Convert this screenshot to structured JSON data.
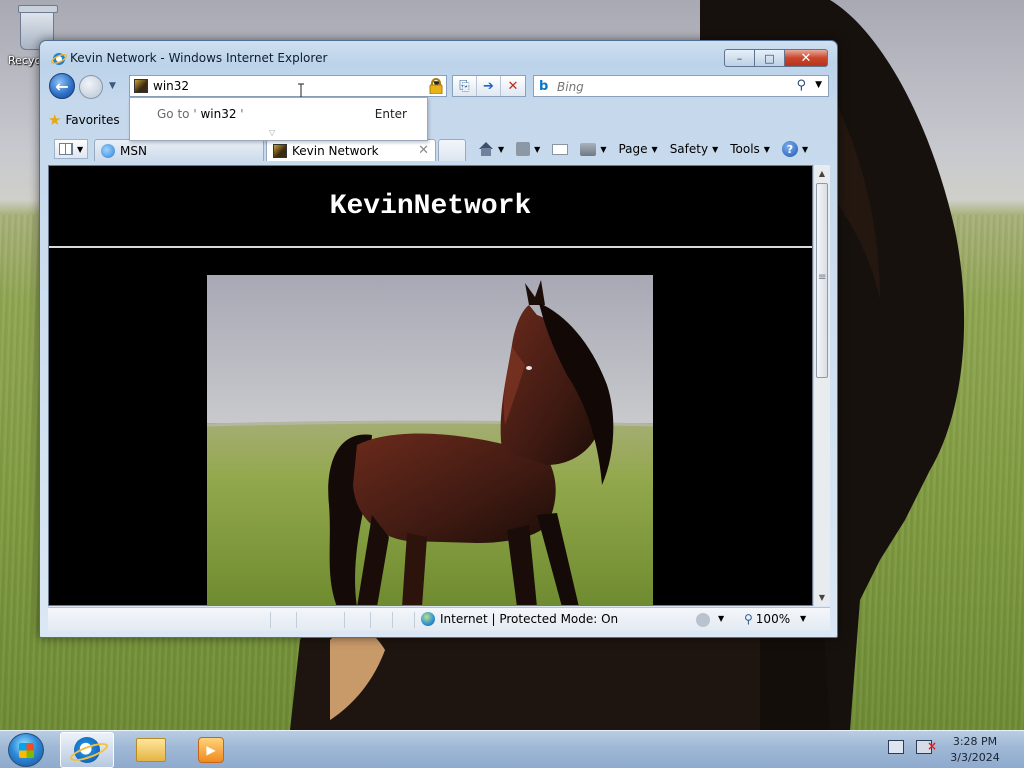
{
  "desktop": {
    "recycle_bin_label": "Recycle Bin"
  },
  "window": {
    "title": "Kevin Network - Windows Internet Explorer",
    "minimize_symbol": "–",
    "maximize_symbol": "□",
    "close_symbol": "✕"
  },
  "navigation": {
    "address_value": "win32",
    "search_placeholder": "Bing",
    "autocomplete": {
      "goto_prefix": "Go to '",
      "goto_value": " win32 ",
      "goto_suffix": "'",
      "action": "Enter"
    }
  },
  "favorites": {
    "label": "Favorites"
  },
  "tabs": [
    {
      "label": "MSN"
    },
    {
      "label": "Kevin Network"
    }
  ],
  "command_bar": {
    "page": "Page",
    "safety": "Safety",
    "tools": "Tools",
    "help_symbol": "?"
  },
  "page": {
    "site_title": "KevinNetwork"
  },
  "status_bar": {
    "zone": "Internet | Protected Mode: On",
    "zoom": "100%"
  },
  "taskbar": {
    "time": "3:28 PM",
    "date": "3/3/2024"
  }
}
